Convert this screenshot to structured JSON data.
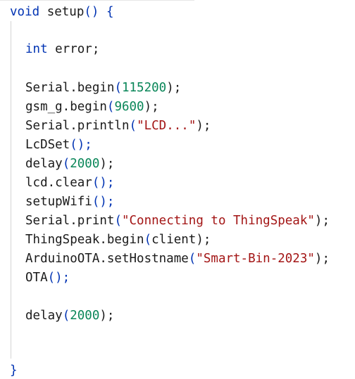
{
  "lines": [
    {
      "tokens": [
        "void",
        " setup",
        "()",
        " {"
      ]
    },
    {
      "tokens": [
        "int",
        " error;"
      ]
    },
    {
      "tokens": [
        "Serial.begin",
        "(",
        "115200",
        ");"
      ]
    },
    {
      "tokens": [
        "gsm_g.begin",
        "(",
        "9600",
        ");"
      ]
    },
    {
      "tokens": [
        "Serial.println",
        "(",
        "\"LCD...\"",
        ");"
      ]
    },
    {
      "tokens": [
        "LcDSet",
        "();"
      ]
    },
    {
      "tokens": [
        "delay",
        "(",
        "2000",
        ");"
      ]
    },
    {
      "tokens": [
        "lcd.clear",
        "();"
      ]
    },
    {
      "tokens": [
        "setupWifi",
        "();"
      ]
    },
    {
      "tokens": [
        "Serial.print",
        "(",
        "\"Connecting to ThingSpeak\"",
        ");"
      ]
    },
    {
      "tokens": [
        "ThingSpeak.begin",
        "(",
        "client",
        ");"
      ]
    },
    {
      "tokens": [
        "ArduinoOTA.setHostname",
        "(",
        "\"Smart-Bin-2023\"",
        ");"
      ]
    },
    {
      "tokens": [
        "OTA",
        "();"
      ]
    },
    {
      "tokens": [
        "delay",
        "(",
        "2000",
        ");"
      ]
    },
    {
      "tokens": [
        "}"
      ]
    }
  ],
  "colors": {
    "keyword": "#0033b3",
    "number": "#098658",
    "string": "#a31515",
    "text": "#1a1a1a"
  }
}
